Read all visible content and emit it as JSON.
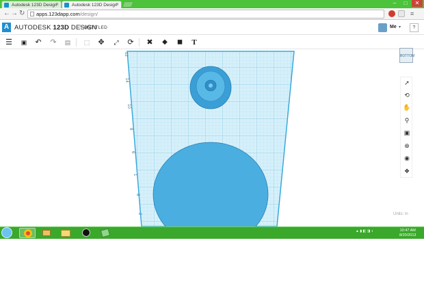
{
  "browser": {
    "tabs": [
      {
        "label": "Autodesk 123D Design",
        "active": false
      },
      {
        "label": "Autodesk 123D Design",
        "active": true
      }
    ],
    "url_domain": "apps.123dapp.com",
    "url_path": "/design/",
    "window_controls": [
      "–",
      "□",
      "✕"
    ]
  },
  "app": {
    "brand_autodesk": "AUTODESK",
    "brand_product": "123D",
    "brand_suffix": "DESIGN",
    "separator": "\\",
    "document_name": "UNTITLED",
    "user_label": "Me",
    "help_label": "?"
  },
  "toolbar": {
    "icons": [
      "menu-icon",
      "save-icon",
      "undo-icon",
      "redo-icon",
      "clipboard-icon",
      "select-icon",
      "move-icon",
      "scale-icon",
      "rotate-icon",
      "modify-icon",
      "primitives-icon",
      "combine-icon",
      "text-icon"
    ],
    "text_tool": "T"
  },
  "workplane": {
    "ruler_labels": [
      "14",
      "10",
      "8",
      "6",
      "1",
      "8",
      "2"
    ],
    "top_label": "12",
    "grid_color": "#bfe6f5",
    "objects": [
      {
        "type": "cylinder-large",
        "color": "#4aaee0"
      },
      {
        "type": "tapered-cylinder-small",
        "color": "#3a9fd6"
      }
    ]
  },
  "viewcube": {
    "label": "BOTTOM"
  },
  "units": {
    "label": "Units: in"
  },
  "taskbar": {
    "time": "10:47 AM",
    "date": "8/20/2013"
  }
}
